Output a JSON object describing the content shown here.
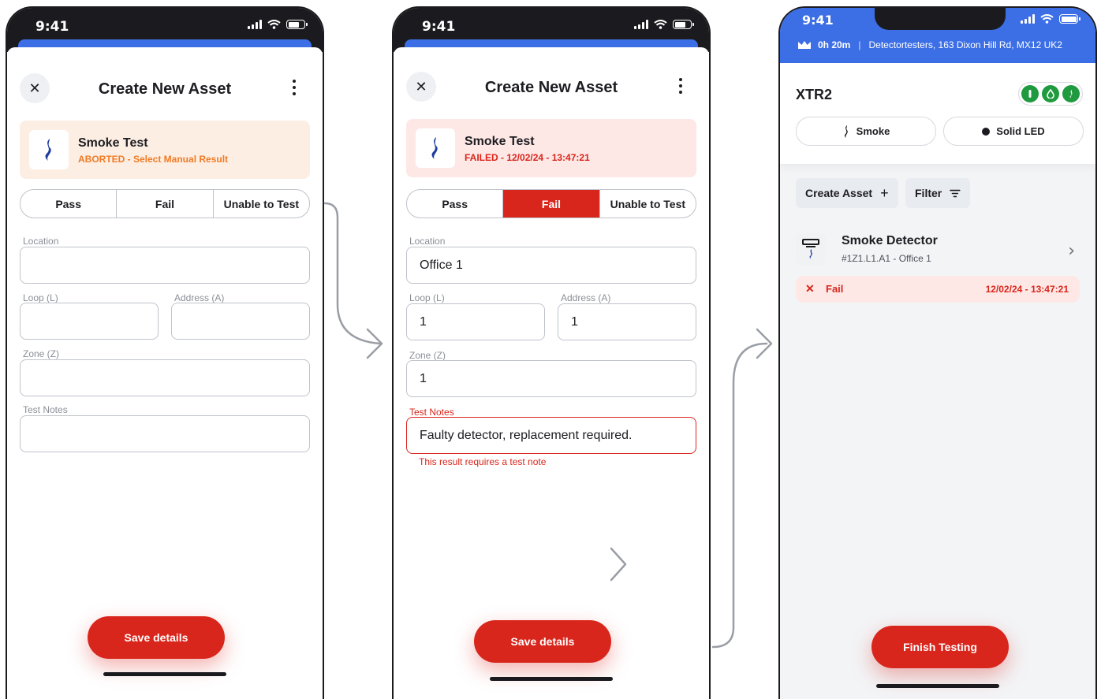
{
  "status_time": "9:41",
  "screen1": {
    "title": "Create New Asset",
    "test_name": "Smoke Test",
    "test_status": "ABORTED - Select Manual Result",
    "segments": [
      "Pass",
      "Fail",
      "Unable to Test"
    ],
    "selected_segment": "",
    "fields": {
      "location_label": "Location",
      "location_value": "",
      "loop_label": "Loop (L)",
      "loop_value": "",
      "address_label": "Address (A)",
      "address_value": "",
      "zone_label": "Zone (Z)",
      "zone_value": "",
      "notes_label": "Test Notes",
      "notes_value": ""
    },
    "save_label": "Save details"
  },
  "screen2": {
    "title": "Create New Asset",
    "test_name": "Smoke Test",
    "test_status": "FAILED - 12/02/24 - 13:47:21",
    "segments": [
      "Pass",
      "Fail",
      "Unable to Test"
    ],
    "selected_segment": "Fail",
    "fields": {
      "location_label": "Location",
      "location_value": "Office 1",
      "loop_label": "Loop (L)",
      "loop_value": "1",
      "address_label": "Address (A)",
      "address_value": "1",
      "zone_label": "Zone (Z)",
      "zone_value": "1",
      "notes_label": "Test Notes",
      "notes_value": "Faulty detector, replacement required."
    },
    "notes_error": "This result requires a test note",
    "save_label": "Save details"
  },
  "screen3": {
    "duration": "0h 20m",
    "site": "Detectortesters, 163 Dixon Hill Rd, MX12 UK2",
    "device_name": "XTR2",
    "badge_icons": [
      "power-icon",
      "drop-icon",
      "flame-icon"
    ],
    "pills": {
      "smoke": "Smoke",
      "led": "Solid LED"
    },
    "create_asset": "Create Asset",
    "filter": "Filter",
    "asset": {
      "name": "Smoke Detector",
      "sub": "#1Z1.L1.A1 - Office 1",
      "result": "Fail",
      "time": "12/02/24 - 13:47:21"
    },
    "finish_label": "Finish Testing"
  },
  "colors": {
    "accent_red": "#d9261c",
    "aborted_orange": "#f07b25",
    "header_blue": "#3c6ee6",
    "pass_green": "#1f9a3f"
  }
}
